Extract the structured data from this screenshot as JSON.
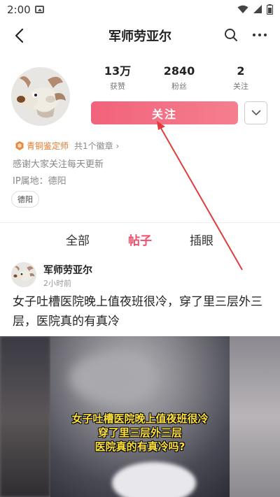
{
  "status_bar": {
    "time": "2:00"
  },
  "nav": {
    "title": "军师劳亚尔"
  },
  "profile": {
    "stats": [
      {
        "value": "13万",
        "label": "获赞"
      },
      {
        "value": "2840",
        "label": "粉丝"
      },
      {
        "value": "2",
        "label": "关注"
      }
    ],
    "follow_label": "关注",
    "badge_title": "青铜鉴定师",
    "badge_count": "共1个徽章 ›",
    "bio": "感谢大家关注每天更新",
    "ip_location": "IP属地：德阳",
    "location_tag": "德阳"
  },
  "tabs": [
    {
      "label": "全部"
    },
    {
      "label": "帖子"
    },
    {
      "label": "插眼"
    }
  ],
  "post": {
    "author": "军师劳亚尔",
    "time": "2小时前",
    "text": "女子吐槽医院晚上值夜班很冷，穿了里三层外三层，医院真的有真冷",
    "caption_lines": [
      "女子吐槽医院晚上值夜班很冷",
      "穿了里三层外三层",
      "医院真的有真冷吗?"
    ]
  },
  "colors": {
    "accent": "#f0506e",
    "follow_button": "#f2637b",
    "badge": "#e07a2e",
    "caption": "#ffe23b",
    "annotation": "#e03c3c"
  }
}
